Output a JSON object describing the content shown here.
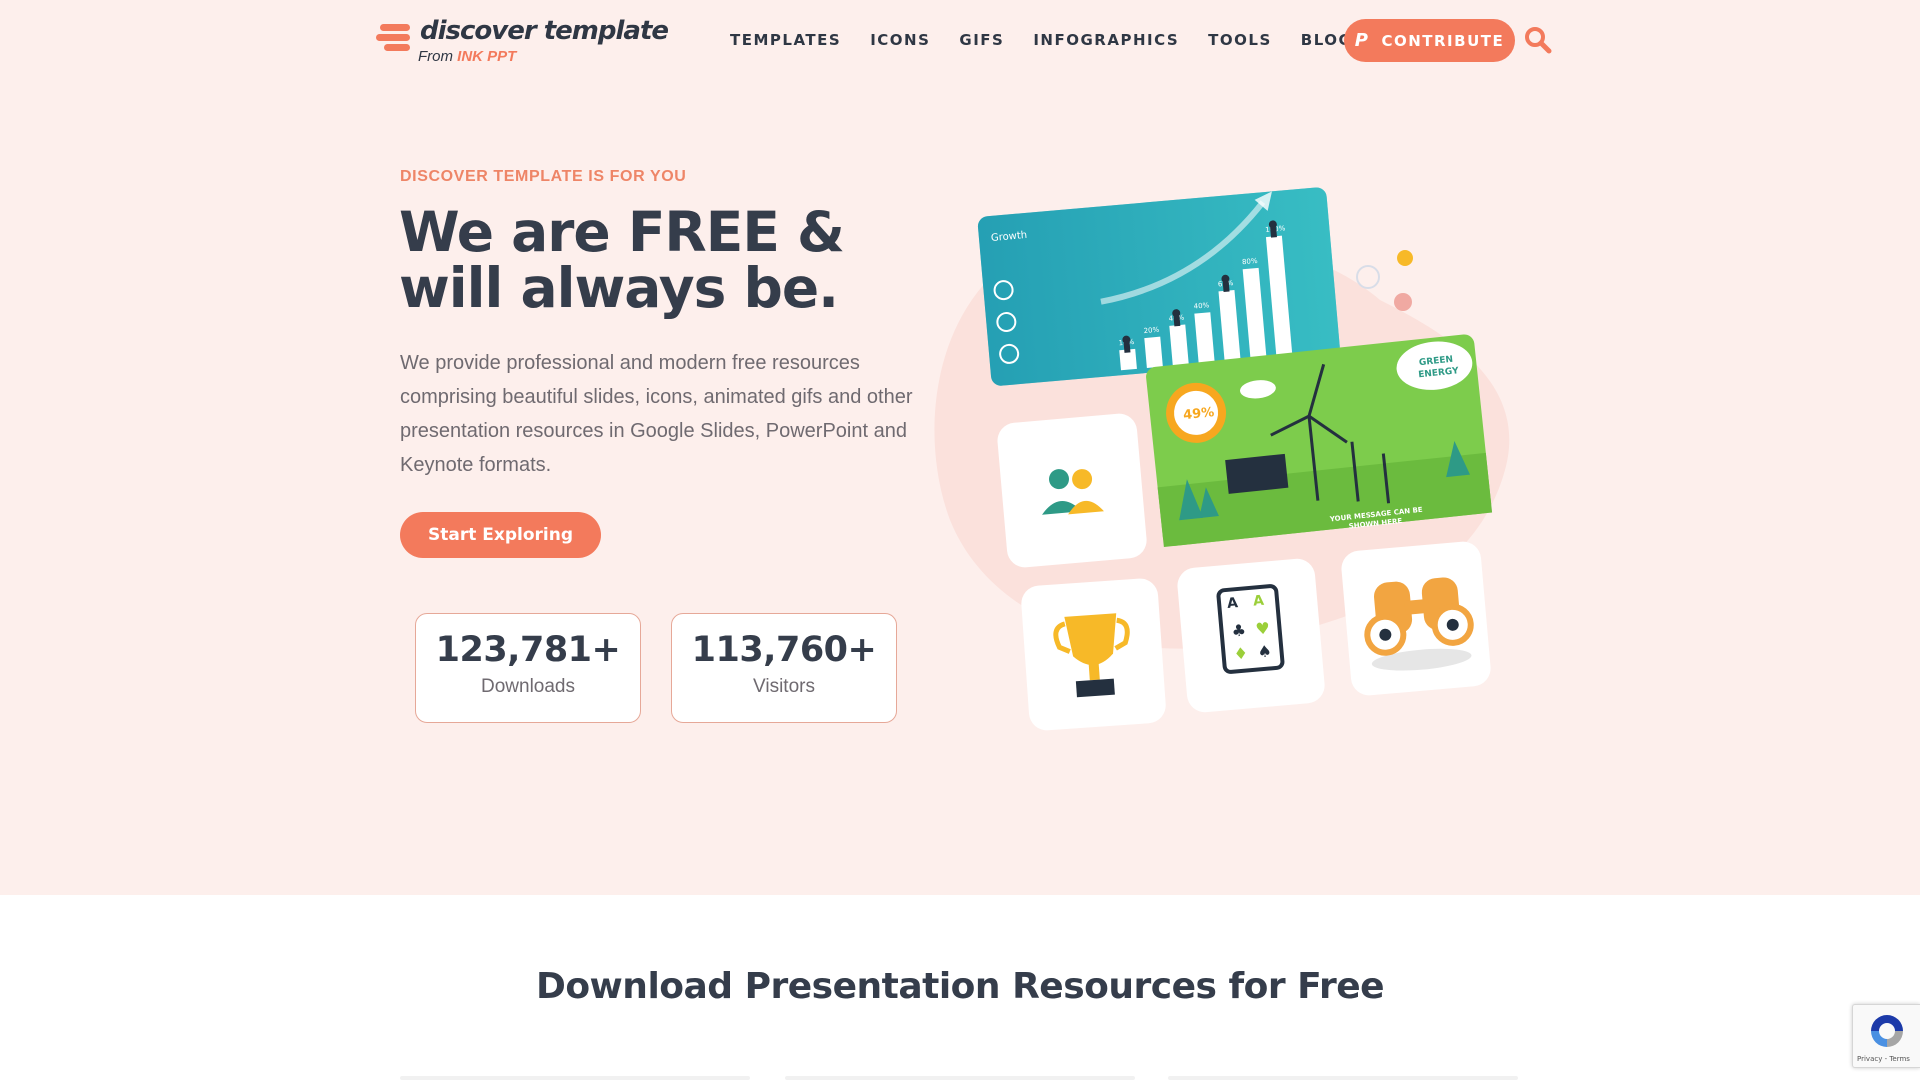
{
  "header": {
    "logo_title": "discover template",
    "logo_from": "From",
    "logo_brand": "INK PPT",
    "nav": [
      "TEMPLATES",
      "ICONS",
      "GIFS",
      "INFOGRAPHICS",
      "TOOLS",
      "BLOGS"
    ],
    "contribute_label": "CONTRIBUTE",
    "contribute_icon": "paypal-icon",
    "search_icon": "search-icon"
  },
  "hero": {
    "eyebrow": "DISCOVER TEMPLATE IS FOR YOU",
    "title": "We are FREE & will always be.",
    "description": "We provide professional and modern free resources comprising beautiful slides, icons, animated gifs and other presentation resources in Google Slides, PowerPoint and Keynote formats.",
    "cta_label": "Start Exploring",
    "stats": [
      {
        "value": "123,781+",
        "label": "Downloads"
      },
      {
        "value": "113,760+",
        "label": "Visitors"
      }
    ]
  },
  "illustration": {
    "growth_slide": {
      "title": "Growth",
      "percentages": [
        "10%",
        "20%",
        "40%",
        "40%",
        "65%",
        "80%",
        "100%"
      ]
    },
    "energy_slide": {
      "badge_value": "49%",
      "cloud_label_1": "GREEN",
      "cloud_label_2": "ENERGY",
      "message_1": "YOUR MESSAGE CAN BE",
      "message_2": "SHOWN HERE"
    },
    "icon_tiles": [
      "people-icon",
      "trophy-icon",
      "playing-card-icon",
      "binoculars-icon"
    ]
  },
  "section": {
    "title": "Download Presentation Resources for Free"
  },
  "recaptcha": {
    "links": "Privacy - Terms"
  },
  "colors": {
    "accent": "#f37a5c",
    "hero_bg": "#fdefec",
    "text_dark": "#353d4b",
    "teal": "#2bb1bf",
    "green": "#7dcc4c"
  }
}
